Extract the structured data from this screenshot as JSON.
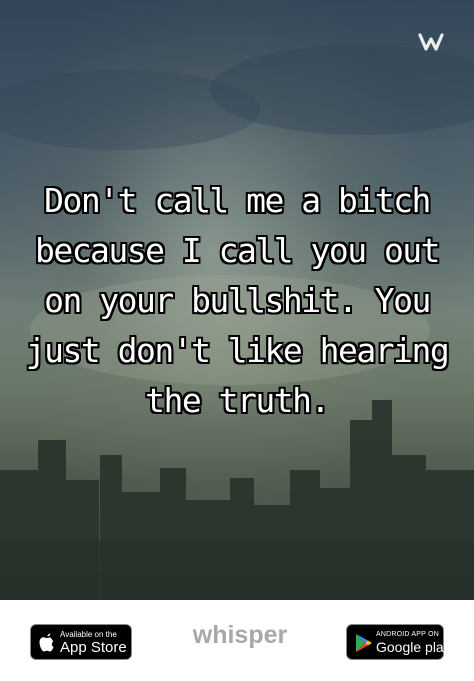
{
  "post": {
    "quote": "Don't call me a bitch because I call you out on your bullshit. You just don't like hearing the truth.",
    "background_icon": "city-skyline-sunset-photo"
  },
  "watermark": {
    "text": "w",
    "icon": "whisper-logo-icon"
  },
  "footer": {
    "app_store": {
      "small_label": "Available on the",
      "big_label": "App Store",
      "icon": "apple-icon"
    },
    "brand_label": "whisper",
    "google_play": {
      "small_label": "ANDROID APP ON",
      "big_label": "Google play",
      "icon": "google-play-icon"
    }
  },
  "colors": {
    "quote_text": "#ffffff",
    "quote_outline": "#000000",
    "brand_text": "#a8a8a8",
    "badge_bg": "#000000"
  }
}
